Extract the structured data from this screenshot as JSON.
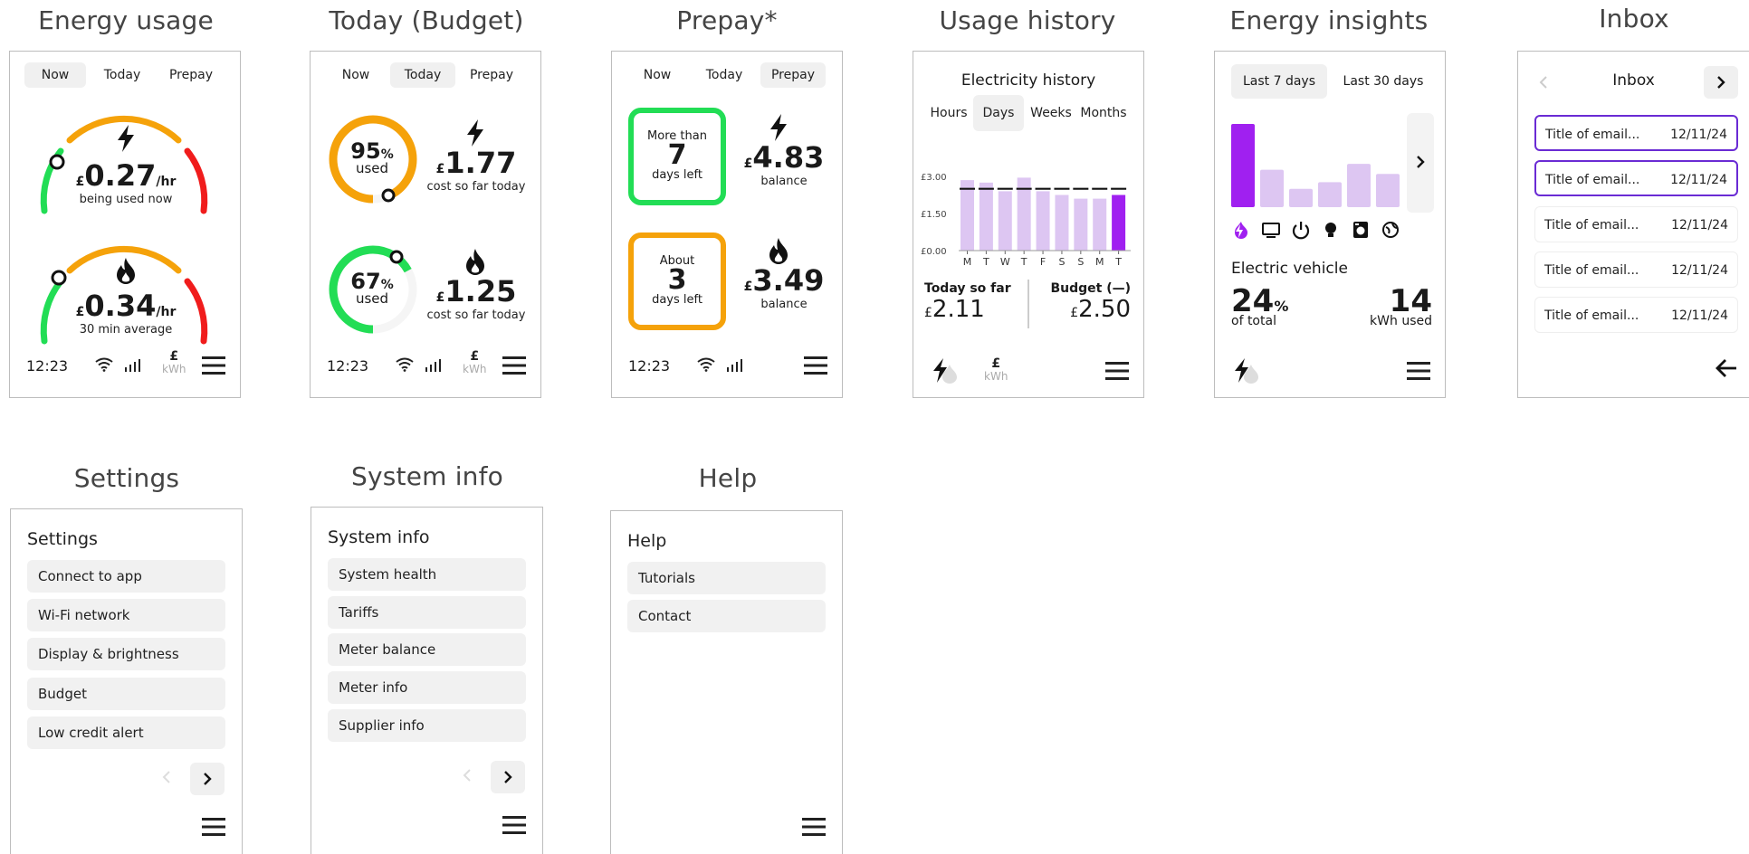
{
  "titles": {
    "energy_usage": "Energy usage",
    "today_budget": "Today (Budget)",
    "prepay": "Prepay*",
    "usage_history": "Usage history",
    "energy_insights": "Energy insights",
    "inbox": "Inbox",
    "settings": "Settings",
    "system_info": "System info",
    "help": "Help"
  },
  "tabs": [
    "Now",
    "Today",
    "Prepay"
  ],
  "status": {
    "time": "12:23",
    "currency": "£",
    "kwh": "kWh"
  },
  "energy_usage": {
    "elec": {
      "currency": "£",
      "value": "0.27",
      "unit": "/hr",
      "caption": "being used now"
    },
    "gas": {
      "currency": "£",
      "value": "0.34",
      "unit": "/hr",
      "caption": "30 min average"
    }
  },
  "today_budget": {
    "elec": {
      "percent": "95",
      "pct_sign": "%",
      "used": "used",
      "currency": "£",
      "value": "1.77",
      "caption": "cost so far today",
      "fraction": 0.95
    },
    "gas": {
      "percent": "67",
      "pct_sign": "%",
      "used": "used",
      "currency": "£",
      "value": "1.25",
      "caption": "cost so far today",
      "fraction": 0.67
    }
  },
  "prepay": {
    "elec": {
      "top": "More than",
      "days": "7",
      "bottom": "days left",
      "currency": "£",
      "value": "4.83",
      "caption": "balance"
    },
    "gas": {
      "top": "About",
      "days": "3",
      "bottom": "days left",
      "currency": "£",
      "value": "3.49",
      "caption": "balance"
    }
  },
  "usage_history": {
    "title": "Electricity history",
    "tabs": [
      "Hours",
      "Days",
      "Weeks",
      "Months"
    ],
    "today_label": "Today so far",
    "today_currency": "£",
    "today_value": "2.11",
    "budget_label": "Budget (—)",
    "budget_currency": "£",
    "budget_value": "2.50"
  },
  "chart_data": {
    "type": "bar",
    "categories": [
      "M",
      "T",
      "W",
      "T",
      "F",
      "S",
      "S",
      "M",
      "T"
    ],
    "values": [
      2.85,
      2.75,
      2.4,
      2.95,
      2.4,
      2.25,
      2.1,
      2.1,
      2.25
    ],
    "budget": 2.5,
    "ytick_labels": [
      "£3.00",
      "£1.50",
      "£0.00"
    ],
    "ylim": [
      0,
      3
    ],
    "colors": {
      "bar": "#ddc6f2",
      "highlight": "#a020f0"
    }
  },
  "insights": {
    "tabs": [
      "Last 7 days",
      "Last 30 days"
    ],
    "bars": [
      1.0,
      0.45,
      0.22,
      0.3,
      0.52,
      0.4
    ],
    "icons": [
      "ev-icon",
      "tv-icon",
      "power-icon",
      "bulb-icon",
      "washer-icon",
      "globe-icon"
    ],
    "category": "Electric vehicle",
    "pct": "24",
    "pct_sign": "%",
    "pct_label": "of total",
    "kwh": "14",
    "kwh_label": "kWh used"
  },
  "inbox": {
    "title": "Inbox",
    "emails": [
      {
        "subject": "Title of email...",
        "date": "12/11/24"
      },
      {
        "subject": "Title of email...",
        "date": "12/11/24"
      },
      {
        "subject": "Title of email...",
        "date": "12/11/24"
      },
      {
        "subject": "Title of email...",
        "date": "12/11/24"
      },
      {
        "subject": "Title of email...",
        "date": "12/11/24"
      }
    ]
  },
  "settings": {
    "title": "Settings",
    "items": [
      "Connect to app",
      "Wi-Fi network",
      "Display & brightness",
      "Budget",
      "Low credit alert"
    ]
  },
  "system_info": {
    "title": "System info",
    "items": [
      "System health",
      "Tariffs",
      "Meter balance",
      "Meter info",
      "Supplier info"
    ]
  },
  "help": {
    "title": "Help",
    "items": [
      "Tutorials",
      "Contact"
    ]
  },
  "colors": {
    "green": "#22dd55",
    "orange": "#f5a20a",
    "red": "#f01c1c",
    "purple": "#a020f0",
    "light_purple": "#ddc6f2",
    "select_border": "#6a2bd4"
  }
}
